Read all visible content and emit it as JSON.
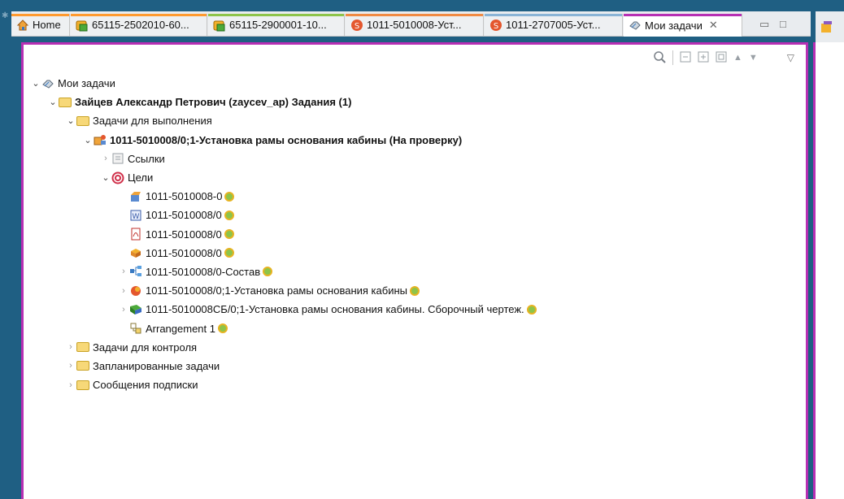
{
  "tabs": [
    {
      "label": "Home",
      "icon": "home-icon",
      "accent": "#ff9a2f"
    },
    {
      "label": "65115-2502010-60...",
      "icon": "item-revision-icon",
      "accent": "#ff9a2f"
    },
    {
      "label": "65115-2900001-10...",
      "icon": "item-revision-icon",
      "accent": "#8dc44a"
    },
    {
      "label": "1011-5010008-Уст...",
      "icon": "process-icon",
      "accent": "#f08a43"
    },
    {
      "label": "1011-2707005-Уст...",
      "icon": "process-icon",
      "accent": "#8ab4d6"
    },
    {
      "label": "Мои задачи",
      "icon": "my-tasks-icon",
      "accent": "#b72fb4",
      "active": true
    }
  ],
  "tree": {
    "root": "Мои задачи",
    "user": "Зайцев Александр Петрович (zaycev_ap) Задания (1)",
    "tasks_to_perform": "Задачи для выполнения",
    "task": "1011-5010008/0;1-Установка рамы основания кабины (На проверку)",
    "references": "Ссылки",
    "targets": "Цели",
    "target_items": [
      "1011-5010008-0",
      "1011-5010008/0",
      "1011-5010008/0",
      "1011-5010008/0",
      "1011-5010008/0-Состав",
      "1011-5010008/0;1-Установка рамы основания кабины",
      "1011-5010008СБ/0;1-Установка рамы основания кабины. Сборочный чертеж.",
      "Arrangement 1"
    ],
    "tasks_to_track": "Задачи для контроля",
    "scheduled_tasks": "Запланированные задачи",
    "subscription_messages": "Сообщения подписки"
  },
  "colors": {
    "panel_border": "#b72fb4",
    "background": "#1f5f83"
  }
}
